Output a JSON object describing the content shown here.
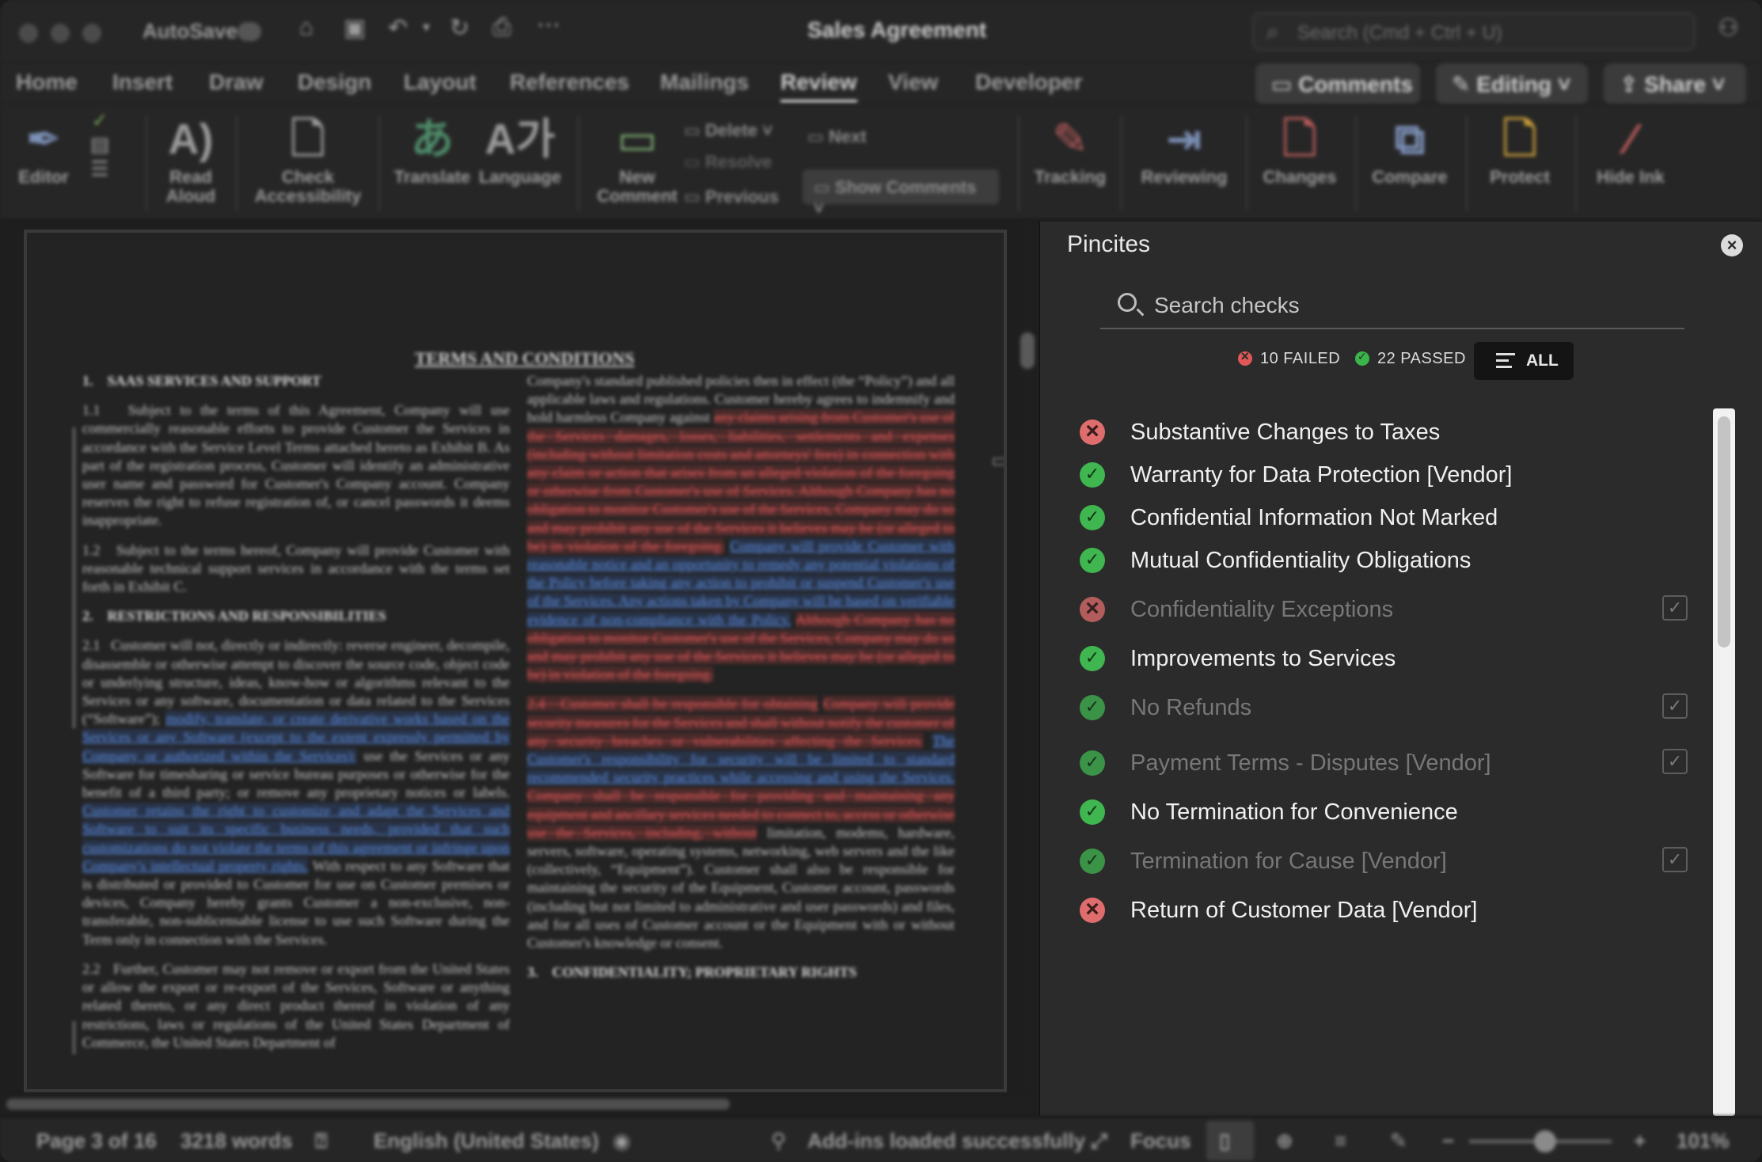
{
  "titlebar": {
    "autosave": "AutoSave",
    "doc_title": "Sales Agreement",
    "search_placeholder": "Search (Cmd + Ctrl + U)"
  },
  "ribbon_tabs": [
    "Home",
    "Insert",
    "Draw",
    "Design",
    "Layout",
    "References",
    "Mailings",
    "Review",
    "View",
    "Developer"
  ],
  "active_tab": "Review",
  "top_buttons": {
    "comments": "Comments",
    "editing": "Editing",
    "share": "Share"
  },
  "ribbon": {
    "editor": "Editor",
    "read_aloud_1": "Read",
    "read_aloud_2": "Aloud",
    "check_acc_1": "Check",
    "check_acc_2": "Accessibility",
    "translate": "Translate",
    "language": "Language",
    "new_comment_1": "New",
    "new_comment_2": "Comment",
    "delete": "Delete",
    "resolve": "Resolve",
    "previous": "Previous",
    "next": "Next",
    "show_comments": "Show Comments",
    "tracking": "Tracking",
    "reviewing": "Reviewing",
    "changes": "Changes",
    "compare": "Compare",
    "protect": "Protect",
    "hide_ink": "Hide Ink"
  },
  "document": {
    "heading": "TERMS AND CONDITIONS",
    "sec1": "1.    SAAS SERVICES AND SUPPORT",
    "p11": "1.1   Subject to the terms of this Agreement, Company will use commercially reasonable efforts to provide Customer the Services in accordance with the Service Level Terms attached hereto as Exhibit B. As part of the registration process, Customer will identify an administrative user name and password for Customer's Company account. Company reserves the right to refuse registration of, or cancel passwords it deems inappropriate.",
    "p12": "1.2   Subject to the terms hereof, Company will provide Customer with reasonable technical support services in accordance with the terms set forth in Exhibit C.",
    "sec2": "2.    RESTRICTIONS AND RESPONSIBILITIES",
    "p21a": "2.1   Customer will not, directly or indirectly: reverse engineer, decompile, disassemble or otherwise attempt to discover the source code, object code or underlying structure, ideas, know-how or algorithms relevant to the Services or any software, documentation or data related to the Services (“Software”);",
    "p21b": "modify, translate, or create derivative works based on the Services or any Software (except to the extent expressly permitted by Company or authorized within the Services);",
    "p21c": "use the Services or any Software for timesharing or service bureau purposes or otherwise for the benefit of a third party; or remove any proprietary notices or labels.",
    "p21d": "Customer retains the right to customize and adapt the Services and Software to suit its specific business needs, provided that such customizations do not violate the terms of this agreement or infringe upon Company's intellectual property rights.",
    "p21e": "With respect to any Software that is distributed or provided to Customer for use on Customer premises or devices, Company hereby grants Customer a non-exclusive, non-transferable, non-sublicensable license to use such Software during the Term only in connection with the Services.",
    "p22": "2.2   Further, Customer may not remove or export from the United States or allow the export or re-export of the Services, Software or anything related thereto, or any direct product thereof in violation of any restrictions, laws or regulations of the United States Department of Commerce, the United States Department of",
    "r1": "Company's standard published policies then in effect (the “Policy”) and all applicable laws and regulations. Customer hereby agrees to indemnify and hold harmless Company against",
    "r2": "any claims arising from Customer's use of the Services damages, losses, liabilities, settlements and expenses (including without limitation costs and attorneys' fees) in connection with any claim or action that arises from an alleged violation of the foregoing or otherwise from Customer's use of Services. Although Company has no obligation to monitor Customer's use of the Services, Company may do so and may prohibit any use of the Services it believes may be (or alleged to be) in violation of the foregoing.",
    "r3": "Company will provide Customer with reasonable notice and an opportunity to remedy any potential violations of the Policy before taking any action to prohibit or suspend Customer's use of the Services. Any actions taken by Company will be based on verifiable evidence of non-compliance with the Policy.",
    "r4": "Although Company has no obligation to monitor Customer's use of the Services, Company may do so and may prohibit any use of the Services it believes may be (or alleged to be) in violation of the foregoing.",
    "r5": "2.4   Customer shall be responsible for obtaining",
    "r6": "Company will provide security measures for the Services and shall without notify the customer of any security breaches or vulnerabilities affecting the Services.",
    "r7": "The Customer's responsibility for security will be limited to standard recommended security practices while accessing and using the Services.",
    "r8": "Company shall be responsible for providing and maintaining any equipment and ancillary services needed to connect to, access or otherwise use the Services, including, without",
    "r9": "limitation, modems, hardware, servers, software, operating systems, networking, web servers and the like (collectively, “Equipment”). Customer shall also be responsible for maintaining the security of the Equipment, Customer account, passwords (including but not limited to administrative and user passwords) and files, and for all uses of Customer account or the Equipment with or without Customer's knowledge or consent.",
    "sec3": "3.    CONFIDENTIALITY; PROPRIETARY RIGHTS"
  },
  "panel": {
    "title": "Pincites",
    "search_placeholder": "Search checks",
    "failed_label": "10 FAILED",
    "passed_label": "22 PASSED",
    "all_label": "ALL",
    "checks": [
      {
        "name": "Substantive Changes to Taxes",
        "status": "fail",
        "muted": false
      },
      {
        "name": "Warranty for Data Protection [Vendor]",
        "status": "pass",
        "muted": false
      },
      {
        "name": "Confidential Information Not Marked",
        "status": "pass",
        "muted": false
      },
      {
        "name": "Mutual Confidentiality Obligations",
        "status": "pass",
        "muted": false
      },
      {
        "name": "Confidentiality Exceptions",
        "status": "fail",
        "muted": true
      },
      {
        "name": "Improvements to Services",
        "status": "pass",
        "muted": false
      },
      {
        "name": "No Refunds",
        "status": "pass",
        "muted": true
      },
      {
        "name": "Payment Terms - Disputes [Vendor]",
        "status": "pass",
        "muted": true
      },
      {
        "name": "No Termination for Convenience",
        "status": "pass",
        "muted": false
      },
      {
        "name": "Termination for Cause [Vendor]",
        "status": "pass",
        "muted": true
      },
      {
        "name": "Return of Customer Data [Vendor]",
        "status": "fail",
        "muted": false
      }
    ]
  },
  "statusbar": {
    "page": "Page 3 of 16",
    "words": "3218 words",
    "language": "English (United States)",
    "addins": "Add-ins loaded successfully",
    "focus": "Focus",
    "zoom": "101%"
  }
}
